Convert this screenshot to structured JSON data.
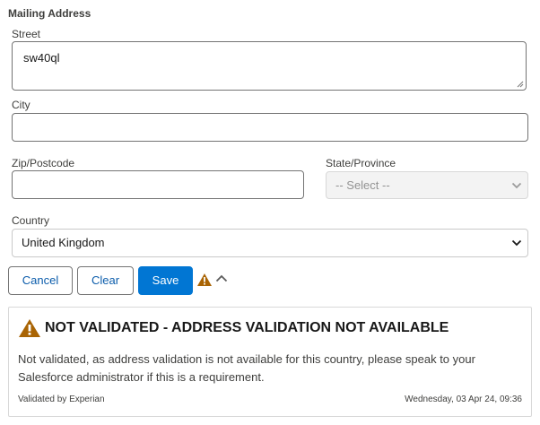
{
  "section": {
    "title": "Mailing Address"
  },
  "street": {
    "label": "Street",
    "value": "sw40ql"
  },
  "city": {
    "label": "City",
    "value": ""
  },
  "zip": {
    "label": "Zip/Postcode",
    "value": ""
  },
  "state": {
    "label": "State/Province",
    "selected": "-- Select --"
  },
  "country": {
    "label": "Country",
    "selected": "United Kingdom"
  },
  "buttons": {
    "cancel": "Cancel",
    "clear": "Clear",
    "save": "Save"
  },
  "validation": {
    "title": "NOT VALIDATED - ADDRESS VALIDATION NOT AVAILABLE",
    "message": "Not validated, as address validation is not available for this country, please speak to your Salesforce administrator if this is a requirement.",
    "validated_by": "Validated by Experian",
    "timestamp": "Wednesday, 03 Apr 24, 09:36"
  },
  "colors": {
    "brand": "#0176d3",
    "link": "#0b5cab",
    "warning": "#a96404"
  },
  "icons": {
    "status": "warning-icon",
    "toggle": "chevron-up-icon",
    "select": "chevron-down-icon"
  }
}
